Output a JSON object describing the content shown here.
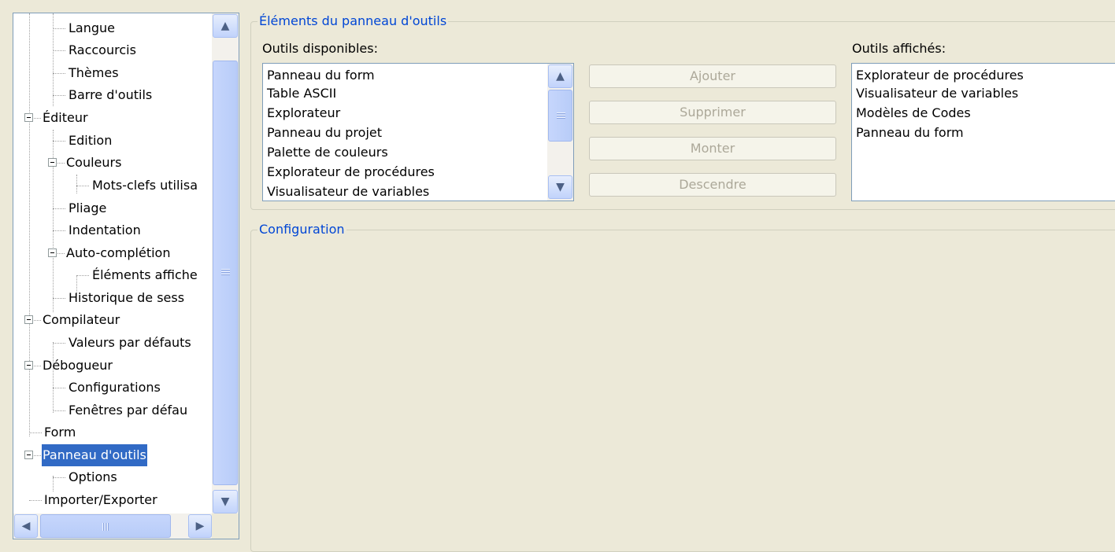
{
  "tree": {
    "items": [
      {
        "label": "Langue"
      },
      {
        "label": "Raccourcis"
      },
      {
        "label": "Thèmes"
      },
      {
        "label": "Barre d'outils"
      },
      {
        "label": "Éditeur"
      },
      {
        "label": "Edition"
      },
      {
        "label": "Couleurs"
      },
      {
        "label": "Mots-clefs utilisa"
      },
      {
        "label": "Pliage"
      },
      {
        "label": "Indentation"
      },
      {
        "label": "Auto-complétion"
      },
      {
        "label": "Éléments affiche"
      },
      {
        "label": "Historique de sess"
      },
      {
        "label": "Compilateur"
      },
      {
        "label": "Valeurs par défauts"
      },
      {
        "label": "Débogueur"
      },
      {
        "label": "Configurations"
      },
      {
        "label": "Fenêtres par défau"
      },
      {
        "label": "Form"
      },
      {
        "label": "Panneau d'outils"
      },
      {
        "label": "Options"
      },
      {
        "label": "Importer/Exporter"
      }
    ],
    "selected": "Panneau d'outils"
  },
  "toolbar_panel": {
    "legend": "Éléments du panneau d'outils",
    "available_label": "Outils disponibles:",
    "available_items": [
      "Panneau du form",
      "Table ASCII",
      "Explorateur",
      "Panneau du projet",
      "Palette de couleurs",
      "Explorateur de procédures",
      "Visualisateur de variables"
    ],
    "displayed_label": "Outils affichés:",
    "displayed_items": [
      "Explorateur de procédures",
      "Visualisateur de variables",
      "Modèles de Codes",
      "Panneau du form"
    ],
    "buttons": {
      "add": "Ajouter",
      "remove": "Supprimer",
      "up": "Monter",
      "down": "Descendre"
    }
  },
  "configuration": {
    "legend": "Configuration"
  },
  "icons": {
    "scroll_up": "▲",
    "scroll_down": "▼",
    "scroll_left": "◀",
    "scroll_right": "▶"
  },
  "colors": {
    "accent": "#0046d5",
    "selection": "#316ac5",
    "disabled_text": "#aca899"
  }
}
